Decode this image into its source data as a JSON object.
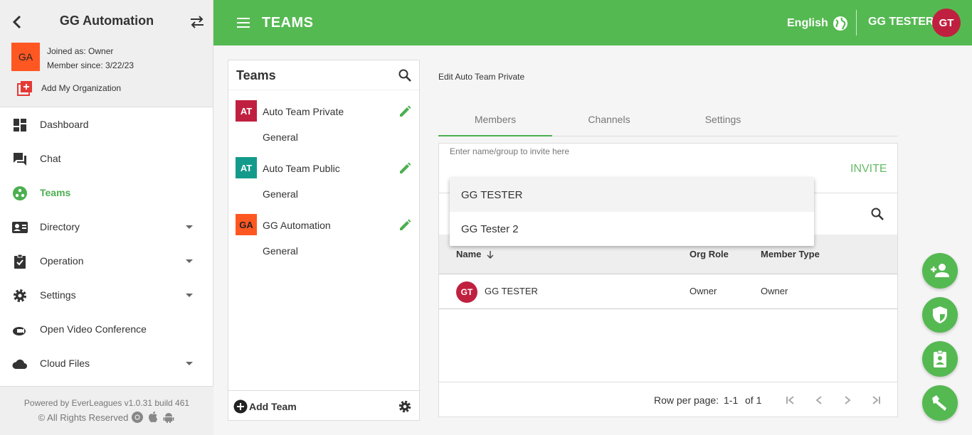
{
  "sidebar": {
    "org_title": "GG Automation",
    "org_avatar": "GA",
    "joined_as": "Joined as: Owner",
    "member_since": "Member since: 3/22/23",
    "add_org_label": "Add My Organization",
    "items": [
      {
        "label": "Dashboard",
        "icon": "dashboard-icon"
      },
      {
        "label": "Chat",
        "icon": "chat-icon"
      },
      {
        "label": "Teams",
        "icon": "teams-icon"
      },
      {
        "label": "Directory",
        "icon": "directory-icon"
      },
      {
        "label": "Operation",
        "icon": "operation-icon"
      },
      {
        "label": "Settings",
        "icon": "gear-icon"
      },
      {
        "label": "Open Video Conference",
        "icon": "video-icon"
      },
      {
        "label": "Cloud Files",
        "icon": "cloud-icon"
      }
    ],
    "footer_line1": "Powered by EverLeagues v1.0.31 build 461",
    "footer_line2": "© All Rights Reserved"
  },
  "topbar": {
    "title": "TEAMS",
    "language": "English",
    "user_name": "GG TESTER",
    "user_avatar": "GT"
  },
  "teams_panel": {
    "title": "Teams",
    "teams": [
      {
        "avatar": "AT",
        "name": "Auto Team Private",
        "sub": "General",
        "color": "#c0203f"
      },
      {
        "avatar": "AT",
        "name": "Auto Team Public",
        "sub": "General",
        "color": "#139a8b"
      },
      {
        "avatar": "GA",
        "name": "GG Automation",
        "sub": "General",
        "color": "#ff5722"
      }
    ],
    "add_team_label": "Add Team"
  },
  "editor": {
    "title": "Edit Auto Team Private",
    "tabs": [
      "Members",
      "Channels",
      "Settings"
    ],
    "invite_placeholder": "Enter name/group to invite here",
    "invite_label": "INVITE",
    "dropdown": [
      "GG TESTER",
      "GG Tester 2"
    ],
    "columns": {
      "name": "Name",
      "org_role": "Org Role",
      "member_type": "Member Type"
    },
    "rows": [
      {
        "avatar": "GT",
        "name": "GG TESTER",
        "org_role": "Owner",
        "member_type": "Owner"
      }
    ],
    "pager": {
      "rows_label": "Row per page:",
      "range": "1-1",
      "of": "of 1"
    }
  },
  "colors": {
    "accent": "#55b952",
    "avatar_red": "#c0203f"
  }
}
